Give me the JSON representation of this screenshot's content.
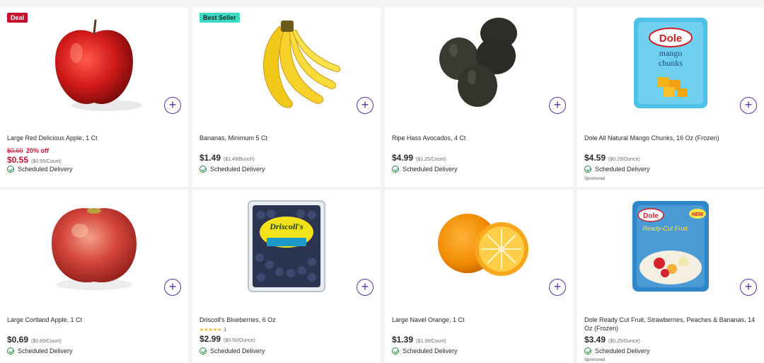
{
  "products": [
    {
      "badge": "Deal",
      "name": "Large Red Delicious Apple, 1 Ct",
      "orig_price": "$0.69",
      "discount": "20% off",
      "price": "$0.55",
      "unit_price": "($0.55/Count)",
      "delivery": "Scheduled Delivery",
      "image_icon": "red-apple-icon"
    },
    {
      "badge": "Best Seller",
      "name": "Bananas, Minimum 5 Ct",
      "price": "$1.49",
      "unit_price": "($1.49/Bunch)",
      "delivery": "Scheduled Delivery",
      "image_icon": "banana-icon"
    },
    {
      "name": "Ripe Hass Avocados, 4 Ct",
      "price": "$4.99",
      "unit_price": "($1.25/Count)",
      "delivery": "Scheduled Delivery",
      "image_icon": "avocado-icon"
    },
    {
      "name": "Dole All Natural Mango Chunks, 16 Oz (Frozen)",
      "price": "$4.59",
      "unit_price": "($0.29/Ounce)",
      "delivery": "Scheduled Delivery",
      "sponsored": "Sponsored",
      "image_icon": "mango-bag-icon",
      "package_text": {
        "brand": "Dole",
        "line1": "mango",
        "line2": "chunks"
      }
    },
    {
      "name": "Large Cortland Apple, 1 Ct",
      "price": "$0.69",
      "unit_price": "($0.69/Count)",
      "delivery": "Scheduled Delivery",
      "image_icon": "cortland-apple-icon"
    },
    {
      "name": "Driscoll's Blueberries, 6 Oz",
      "rating_count": "1",
      "rating_stars": 5,
      "price": "$2.99",
      "unit_price": "($0.50/Ounce)",
      "delivery": "Scheduled Delivery",
      "image_icon": "blueberry-box-icon",
      "package_text": {
        "brand": "Driscoll's"
      }
    },
    {
      "name": "Large Navel Orange, 1 Ct",
      "price": "$1.39",
      "unit_price": "($1.39/Count)",
      "delivery": "Scheduled Delivery",
      "image_icon": "orange-icon"
    },
    {
      "name": "Dole Ready Cut Fruit, Strawberries, Peaches & Bananas, 14 Oz (Frozen)",
      "price": "$3.49",
      "unit_price": "($0.25/Ounce)",
      "delivery": "Scheduled Delivery",
      "sponsored": "Sponsored",
      "image_icon": "mixed-fruit-bag-icon",
      "package_text": {
        "brand": "Dole",
        "line1": "Ready-Cut Fruit",
        "badge": "NEW"
      }
    }
  ],
  "add_button_label": "+",
  "colors": {
    "accent": "#5b2ea6",
    "sale": "#c8102e",
    "check": "#1a8a3a",
    "best_seller": "#3fd9c3"
  }
}
